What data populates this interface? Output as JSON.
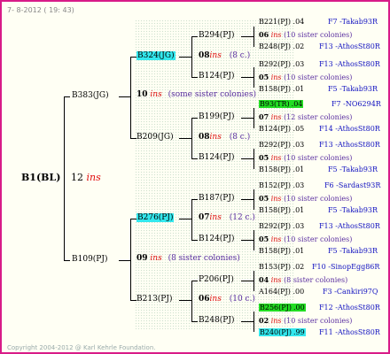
{
  "header": {
    "date": "7-  8-2012 ( 19: 43)"
  },
  "footer": {
    "copyright": "Copyright 2004-2012 @ Karl Kehrle Foundation."
  },
  "colors": {
    "border": "#d81b88",
    "ins": "#e01010",
    "note": "#5a2ea0",
    "breeder": "#1010c0",
    "highlight_cyan": "#33e8ee",
    "highlight_green": "#22dd22"
  },
  "root": {
    "name": "B1(BL)",
    "num": "12",
    "ins": "ins"
  },
  "gen1": {
    "a": {
      "name": "B383(JG)",
      "num": "10",
      "ins": "ins",
      "note": "(some sister colonies)"
    },
    "b": {
      "name": "B109(PJ)",
      "num": "09",
      "ins": "ins",
      "note": "(8 sister colonies)"
    }
  },
  "gen2": {
    "a": {
      "name": "B324(JG)",
      "num": "08",
      "ins": "ins",
      "note": "(8 c.)"
    },
    "b": {
      "name": "B209(JG)",
      "num": "08",
      "ins": "ins",
      "note": "(8 c.)"
    },
    "c": {
      "name": "B276(PJ)",
      "num": "07",
      "ins": "ins",
      "note": "(12 c.)"
    },
    "d": {
      "name": "B213(PJ)",
      "num": "06",
      "ins": "ins",
      "note": "(10 c.)"
    }
  },
  "gen3": [
    {
      "name": "B294(PJ)"
    },
    {
      "name": "B124(PJ)"
    },
    {
      "name": "B199(PJ)"
    },
    {
      "name": "B124(PJ)"
    },
    {
      "name": "B187(PJ)"
    },
    {
      "name": "B124(PJ)"
    },
    {
      "name": "P206(PJ)"
    },
    {
      "name": "B248(PJ)"
    }
  ],
  "gen3_mid": [
    {
      "num": "08",
      "ins": "ins",
      "note": "(8 c.)"
    },
    {
      "num": "08",
      "ins": "ins",
      "note": "(8 c.)"
    },
    {
      "num": "07",
      "ins": "ins",
      "note": "(12 c.)"
    },
    {
      "num": "06",
      "ins": "ins",
      "note": "(10 c.)"
    }
  ],
  "gen4": [
    {
      "name": "B221(PJ)",
      "val": ".04",
      "breeder": "F7 -Takab93R"
    },
    {
      "name": "B248(PJ)",
      "val": ".02",
      "breeder": "F13 -AthosSt80R"
    },
    {
      "name": "B292(PJ)",
      "val": ".03",
      "breeder": "F13 -AthosSt80R"
    },
    {
      "name": "B158(PJ)",
      "val": ".01",
      "breeder": "F5 -Takab93R"
    },
    {
      "name": "B93(TR)",
      "val": ".04",
      "breeder": "F7 -NO6294R"
    },
    {
      "name": "B124(PJ)",
      "val": ".05",
      "breeder": "F14 -AthosSt80R"
    },
    {
      "name": "B292(PJ)",
      "val": ".03",
      "breeder": "F13 -AthosSt80R"
    },
    {
      "name": "B158(PJ)",
      "val": ".01",
      "breeder": "F5 -Takab93R"
    },
    {
      "name": "B152(PJ)",
      "val": ".03",
      "breeder": "F6 -Sardast93R"
    },
    {
      "name": "B158(PJ)",
      "val": ".01",
      "breeder": "F5 -Takab93R"
    },
    {
      "name": "B292(PJ)",
      "val": ".03",
      "breeder": "F13 -AthosSt80R"
    },
    {
      "name": "B158(PJ)",
      "val": ".01",
      "breeder": "F5 -Takab93R"
    },
    {
      "name": "B153(PJ)",
      "val": ".02",
      "breeder": "F10 -SinopEgg86R"
    },
    {
      "name": "A164(PJ)",
      "val": ".00",
      "breeder": "F3 -Cankiri97Q"
    },
    {
      "name": "B256(PJ)",
      "val": ".00",
      "breeder": "F12 -AthosSt80R"
    },
    {
      "name": "B240(PJ)",
      "val": ".99",
      "breeder": "F11 -AthosSt80R"
    }
  ],
  "gen4_mid": [
    {
      "num": "06",
      "ins": "ins",
      "note": "(10 sister colonies)"
    },
    {
      "num": "05",
      "ins": "ins",
      "note": "(10 sister colonies)"
    },
    {
      "num": "07",
      "ins": "ins",
      "note": "(12 sister colonies)"
    },
    {
      "num": "05",
      "ins": "ins",
      "note": "(10 sister colonies)"
    },
    {
      "num": "05",
      "ins": "ins",
      "note": "(10 sister colonies)"
    },
    {
      "num": "05",
      "ins": "ins",
      "note": "(10 sister colonies)"
    },
    {
      "num": "04",
      "ins": "ins",
      "note": "(8 sister colonies)"
    },
    {
      "num": "02",
      "ins": "ins",
      "note": "(10 sister colonies)"
    }
  ]
}
